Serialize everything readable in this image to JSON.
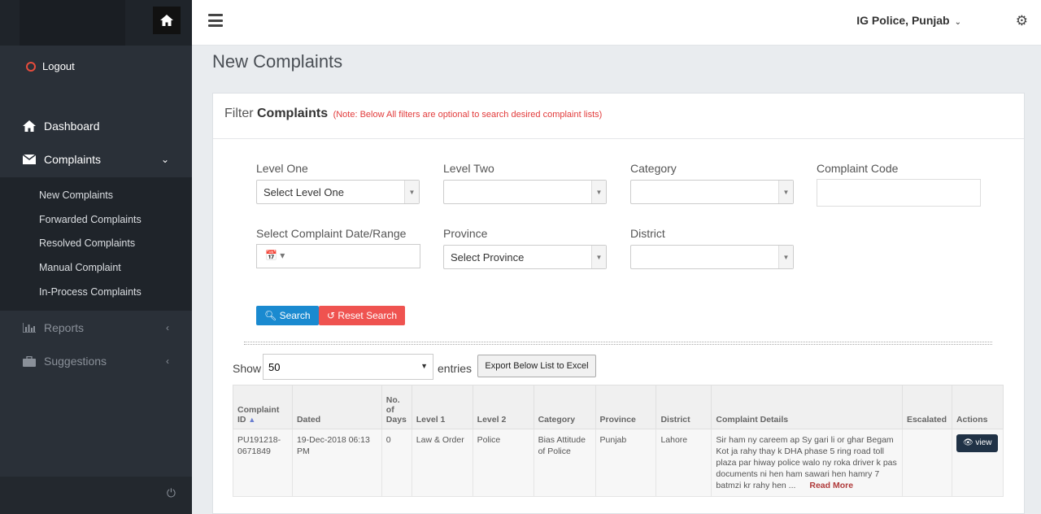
{
  "sidebar": {
    "logout_label": "Logout",
    "items": [
      {
        "label": "Dashboard"
      },
      {
        "label": "Complaints"
      },
      {
        "label": "Reports"
      },
      {
        "label": "Suggestions"
      }
    ],
    "submenu": [
      "New Complaints",
      "Forwarded Complaints",
      "Resolved Complaints",
      "Manual Complaint",
      "In-Process Complaints"
    ]
  },
  "topbar": {
    "user": "IG Police, Punjab"
  },
  "page": {
    "title": "New Complaints"
  },
  "filter": {
    "title_prefix": "Filter ",
    "title_bold": "Complaints",
    "note": "(Note: Below All filters are optional to search desired complaint lists)",
    "level_one_label": "Level One",
    "level_one_value": "Select Level One",
    "level_two_label": "Level Two",
    "level_two_value": "",
    "category_label": "Category",
    "category_value": "",
    "complaint_code_label": "Complaint Code",
    "date_label": "Select Complaint Date/Range",
    "province_label": "Province",
    "province_value": "Select Province",
    "district_label": "District",
    "district_value": "",
    "search_btn": "Search",
    "reset_btn": "Reset Search"
  },
  "list": {
    "show_label": "Show",
    "entries_value": "50",
    "entries_label": "entries",
    "export_btn": "Export Below List to Excel"
  },
  "table": {
    "headers": [
      "Complaint ID",
      "Dated",
      "No. of Days",
      "Level 1",
      "Level 2",
      "Category",
      "Province",
      "District",
      "Complaint Details",
      "Escalated",
      "Actions"
    ],
    "rows": [
      {
        "id": "PU191218-0671849",
        "dated": "19-Dec-2018 06:13 PM",
        "days": "0",
        "level1": "Law & Order",
        "level2": "Police",
        "category": "Bias Attitude of Police",
        "province": "Punjab",
        "district": "Lahore",
        "details": "Sir ham ny careem ap Sy gari li or ghar Begam Kot ja rahy thay k DHA phase 5 ring road toll plaza par hiway police walo ny roka driver k pas documents ni hen ham sawari hen hamry 7 batmzi kr rahy hen ...",
        "read_more": "Read More",
        "escalated": "",
        "action": "view"
      }
    ]
  }
}
